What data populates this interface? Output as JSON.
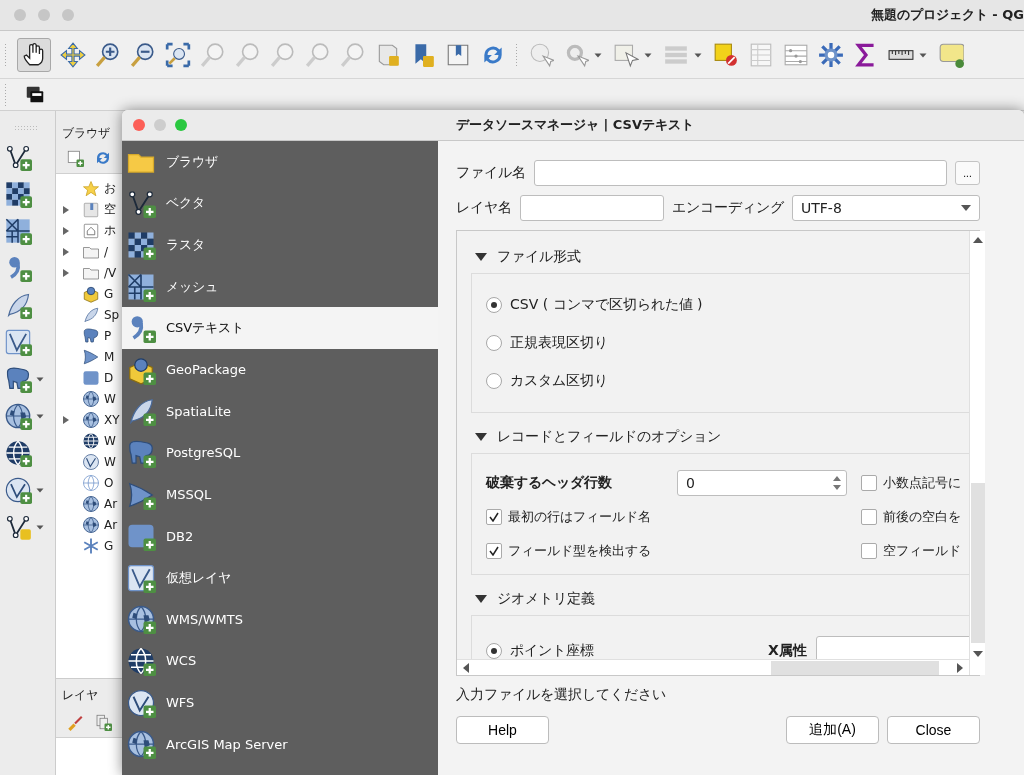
{
  "main_window": {
    "title": "無題のプロジェクト - QG",
    "pan_tool_selected": true
  },
  "browser_panel": {
    "title": "ブラウザ",
    "items": [
      {
        "label": "お",
        "expandable": false
      },
      {
        "label": "空",
        "expandable": true
      },
      {
        "label": "ホ",
        "expandable": true
      },
      {
        "label": "/",
        "expandable": true
      },
      {
        "label": "/V",
        "expandable": true
      },
      {
        "label": "G",
        "expandable": false
      },
      {
        "label": "Sp",
        "expandable": false
      },
      {
        "label": "P",
        "expandable": false
      },
      {
        "label": "M",
        "expandable": false
      },
      {
        "label": "D",
        "expandable": false
      },
      {
        "label": "W",
        "expandable": false
      },
      {
        "label": "XY",
        "expandable": true
      },
      {
        "label": "W",
        "expandable": false
      },
      {
        "label": "W",
        "expandable": false
      },
      {
        "label": "O",
        "expandable": false
      },
      {
        "label": "Ar",
        "expandable": false
      },
      {
        "label": "Ar",
        "expandable": false
      },
      {
        "label": "G",
        "expandable": false
      }
    ]
  },
  "layers_panel": {
    "title": "レイヤ"
  },
  "dialog": {
    "title": "データソースマネージャ | CSVテキスト",
    "sidebar": [
      {
        "label": "ブラウザ",
        "selected": false
      },
      {
        "label": "ベクタ",
        "selected": false
      },
      {
        "label": "ラスタ",
        "selected": false
      },
      {
        "label": "メッシュ",
        "selected": false
      },
      {
        "label": "CSVテキスト",
        "selected": true
      },
      {
        "label": "GeoPackage",
        "selected": false
      },
      {
        "label": "SpatiaLite",
        "selected": false
      },
      {
        "label": "PostgreSQL",
        "selected": false
      },
      {
        "label": "MSSQL",
        "selected": false
      },
      {
        "label": "DB2",
        "selected": false
      },
      {
        "label": "仮想レイヤ",
        "selected": false
      },
      {
        "label": "WMS/WMTS",
        "selected": false
      },
      {
        "label": "WCS",
        "selected": false
      },
      {
        "label": "WFS",
        "selected": false
      },
      {
        "label": "ArcGIS Map Server",
        "selected": false
      }
    ],
    "file_name": {
      "label": "ファイル名"
    },
    "browse_button": "...",
    "layer_name": {
      "label": "レイヤ名"
    },
    "encoding": {
      "label": "エンコーディング",
      "value": "UTF-8"
    },
    "sections": [
      {
        "kind": "radios",
        "title": "ファイル形式",
        "expanded": true,
        "options": [
          {
            "label": "CSV ( コンマで区切られた値 )",
            "selected": true
          },
          {
            "label": "正規表現区切り",
            "selected": false
          },
          {
            "label": "カスタム区切り",
            "selected": false
          }
        ]
      },
      {
        "kind": "options",
        "title": "レコードとフィールドのオプション",
        "expanded": true,
        "header_rows": {
          "label": "破棄するヘッダ行数",
          "value": "0"
        },
        "checks_left": [
          {
            "label": "最初の行はフィールド名",
            "checked": true
          },
          {
            "label": "フィールド型を検出する",
            "checked": true
          }
        ],
        "checks_right": [
          {
            "label": "小数点記号に",
            "checked": false
          },
          {
            "label": "前後の空白を",
            "checked": false
          },
          {
            "label": "空フィールド",
            "checked": false
          }
        ]
      },
      {
        "kind": "geometry",
        "title": "ジオメトリ定義",
        "expanded": true,
        "options": [
          {
            "label": "ポイント座標",
            "selected": true
          }
        ],
        "fields": [
          {
            "label": "X属性"
          }
        ]
      }
    ],
    "status": "入力ファイルを選択してください",
    "buttons": [
      {
        "label": "Help"
      },
      {
        "label": "追加(A)"
      },
      {
        "label": "Close"
      }
    ]
  }
}
